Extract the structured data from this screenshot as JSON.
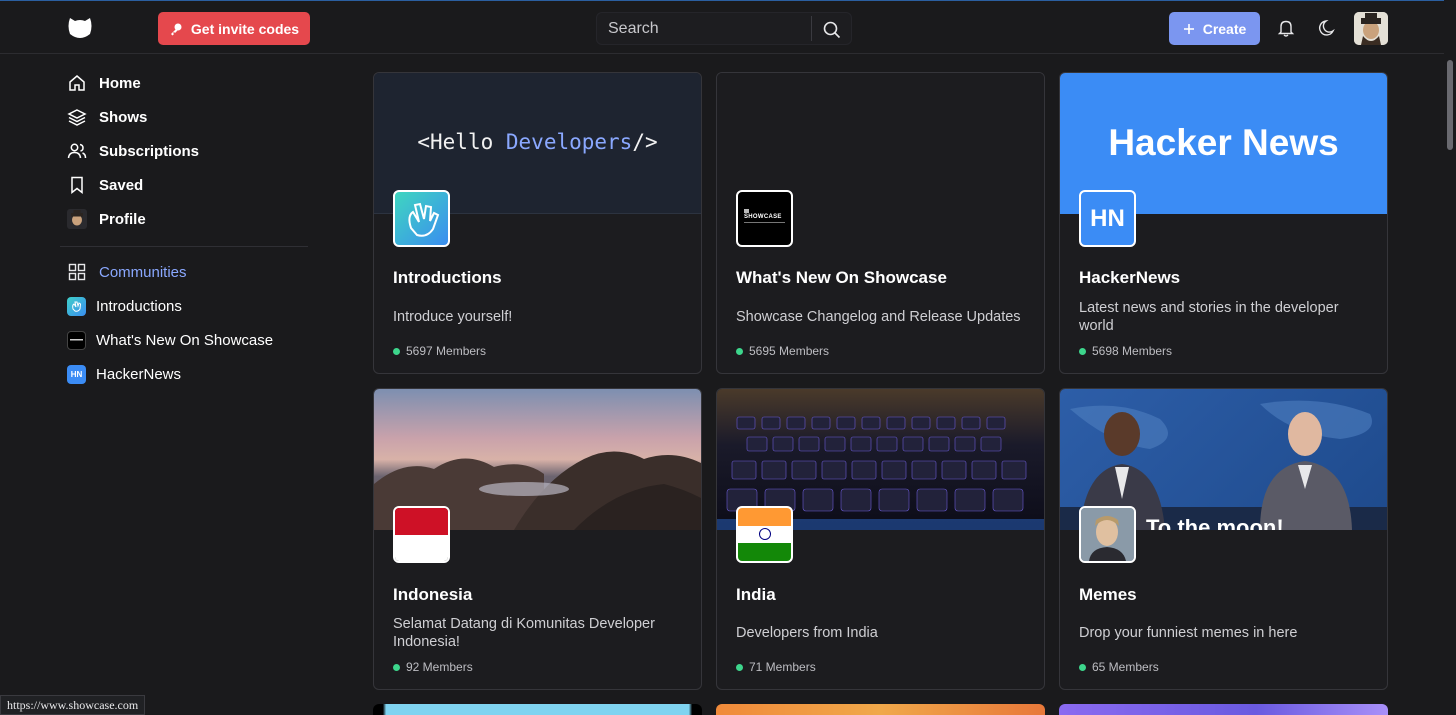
{
  "header": {
    "invite_label": "Get invite codes",
    "search_placeholder": "Search",
    "create_label": "Create"
  },
  "sidebar": {
    "nav": [
      {
        "label": "Home",
        "icon": "home-icon"
      },
      {
        "label": "Shows",
        "icon": "layers-icon"
      },
      {
        "label": "Subscriptions",
        "icon": "users-icon"
      },
      {
        "label": "Saved",
        "icon": "bookmark-icon"
      },
      {
        "label": "Profile",
        "icon": "avatar"
      }
    ],
    "communities_label": "Communities",
    "communities": [
      {
        "label": "Introductions"
      },
      {
        "label": "What's New On Showcase"
      },
      {
        "label": "HackerNews",
        "badge": "HN"
      }
    ]
  },
  "cards": [
    {
      "title": "Introductions",
      "desc": "Introduce yourself!",
      "members": "5697 Members",
      "banner_text_a": "<Hello ",
      "banner_text_b": "Developers",
      "banner_text_c": "/>"
    },
    {
      "title": "What's New On Showcase",
      "desc": "Showcase Changelog and Release Updates",
      "members": "5695 Members",
      "thumb_text": "SHOWCASE"
    },
    {
      "title": "HackerNews",
      "desc": "Latest news and stories in the developer world",
      "members": "5698 Members",
      "banner_text": "Hacker News",
      "thumb_text": "HN"
    },
    {
      "title": "Indonesia",
      "desc": "Selamat Datang di Komunitas Developer Indonesia!",
      "members": "92 Members"
    },
    {
      "title": "India",
      "desc": "Developers from India",
      "members": "71 Members"
    },
    {
      "title": "Memes",
      "desc": "Drop your funniest memes in here",
      "members": "65 Members",
      "banner_caption": "To the moon!"
    }
  ],
  "status_url": "https://www.showcase.com",
  "colors": {
    "accent": "#7b96f0",
    "invite": "#e5484d",
    "hn_blue": "#3b8cf5",
    "member_dot": "#3dd68c"
  }
}
